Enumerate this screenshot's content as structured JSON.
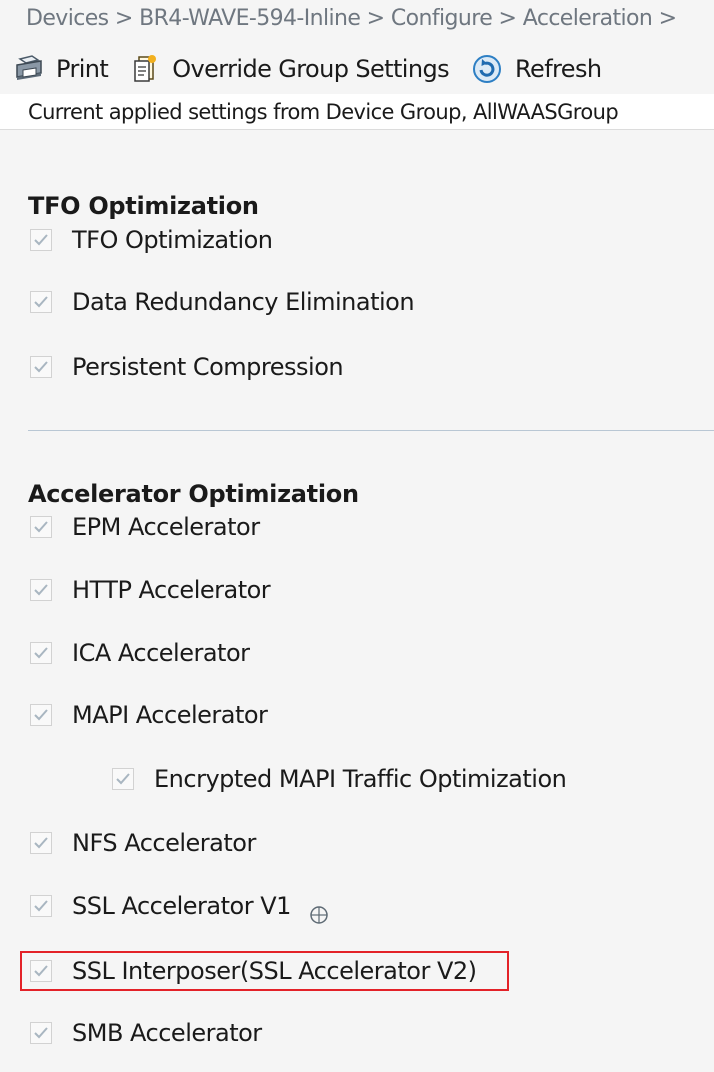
{
  "breadcrumb": "Devices > BR4-WAVE-594-Inline > Configure > Acceleration >",
  "toolbar": {
    "print_label": "Print",
    "override_label": "Override Group Settings",
    "refresh_label": "Refresh"
  },
  "applied_message": "Current applied settings from Device Group, AllWAASGroup",
  "tfo_section": {
    "title": "TFO Optimization",
    "items": [
      {
        "label": "TFO Optimization",
        "checked": true
      },
      {
        "label": "Data Redundancy Elimination",
        "checked": true
      },
      {
        "label": "Persistent Compression",
        "checked": true
      }
    ]
  },
  "accel_section": {
    "title": "Accelerator Optimization",
    "items": [
      {
        "label": "EPM Accelerator",
        "checked": true
      },
      {
        "label": "HTTP Accelerator",
        "checked": true
      },
      {
        "label": "ICA Accelerator",
        "checked": true
      },
      {
        "label": "MAPI Accelerator",
        "checked": true
      },
      {
        "label": "Encrypted MAPI Traffic Optimization",
        "checked": true
      },
      {
        "label": "NFS Accelerator",
        "checked": true
      },
      {
        "label": "SSL Accelerator V1",
        "checked": true
      },
      {
        "label": "SSL Interposer(SSL Accelerator V2)",
        "checked": true
      },
      {
        "label": "SMB Accelerator",
        "checked": true
      }
    ]
  },
  "colors": {
    "highlight": "#e32228",
    "check": "#a9b6c1",
    "refresh_icon": "#2d7fc4"
  },
  "icons": {
    "print": "printer-icon",
    "override": "document-icon",
    "refresh": "refresh-icon",
    "info": "crosshair-info-icon"
  }
}
